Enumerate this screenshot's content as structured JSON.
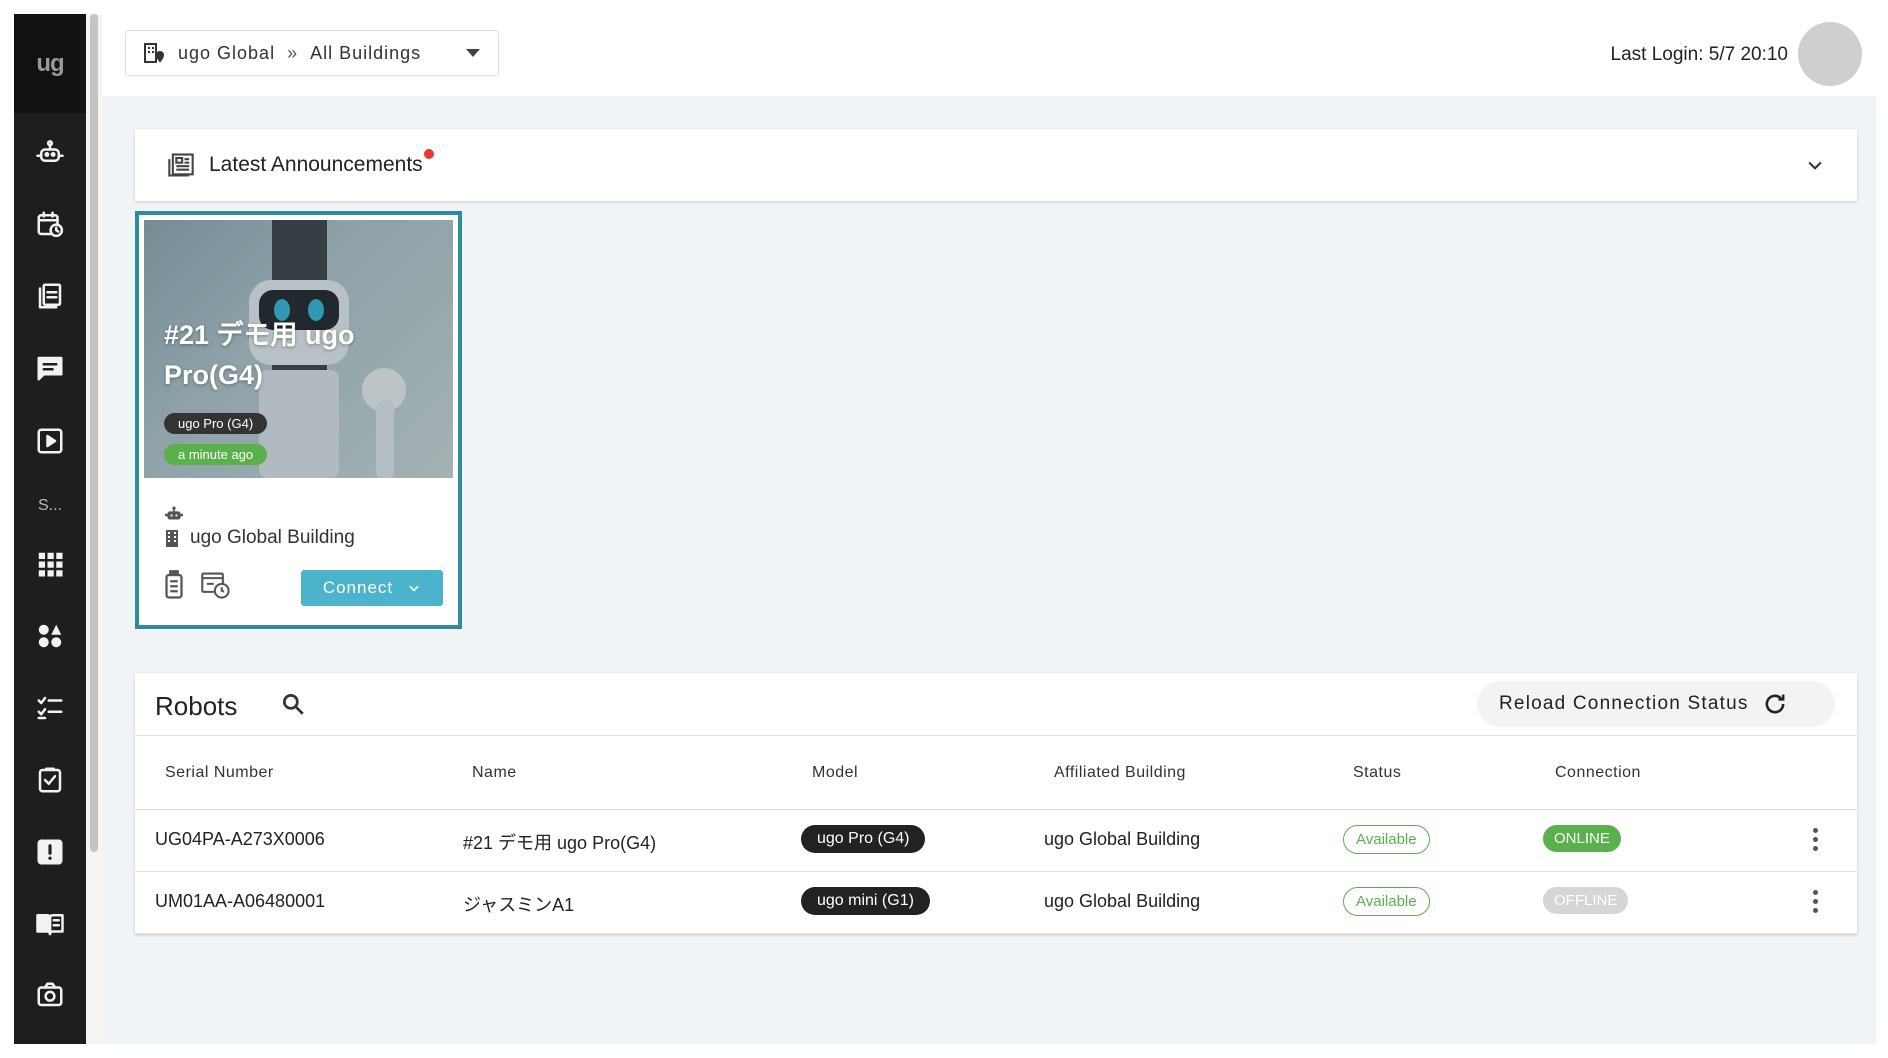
{
  "sidebar": {
    "logo": "ug",
    "section_label": "S...",
    "items": [
      {
        "name": "robot-icon"
      },
      {
        "name": "schedule-icon"
      },
      {
        "name": "document-icon"
      },
      {
        "name": "chat-icon"
      },
      {
        "name": "play-icon"
      },
      {
        "name": "apps-grid-icon"
      },
      {
        "name": "shapes-icon"
      },
      {
        "name": "checklist-icon"
      },
      {
        "name": "task-check-icon"
      },
      {
        "name": "alert-icon"
      },
      {
        "name": "manual-book-icon"
      },
      {
        "name": "camera-icon"
      }
    ]
  },
  "header": {
    "org": "ugo Global",
    "separator": "»",
    "building": "All Buildings",
    "last_login": "Last Login: 5/7 20:10"
  },
  "announcements": {
    "title": "Latest Announcements",
    "has_unread": true,
    "unread_color": "#e53935"
  },
  "robot_card": {
    "title": "#21 デモ用 ugo Pro(G4)",
    "model": "ugo Pro (G4)",
    "last_seen": "a minute ago",
    "building": "ugo Global Building",
    "connect_label": "Connect",
    "accent_color": "#2f8c9e",
    "button_color": "#4cb3cc"
  },
  "robots": {
    "title": "Robots",
    "reload_label": "Reload Connection Status",
    "columns": [
      "Serial Number",
      "Name",
      "Model",
      "Affiliated Building",
      "Status",
      "Connection"
    ],
    "rows": [
      {
        "serial": "UG04PA-A273X0006",
        "name": "#21 デモ用 ugo Pro(G4)",
        "model": "ugo Pro (G4)",
        "building": "ugo Global Building",
        "status": "Available",
        "connection": "ONLINE",
        "connection_color": "#5ab14c"
      },
      {
        "serial": "UM01AA-A06480001",
        "name": "ジャスミンA1",
        "model": "ugo mini (G1)",
        "building": "ugo Global Building",
        "status": "Available",
        "connection": "OFFLINE",
        "connection_color": "#d6d6d6"
      }
    ]
  }
}
